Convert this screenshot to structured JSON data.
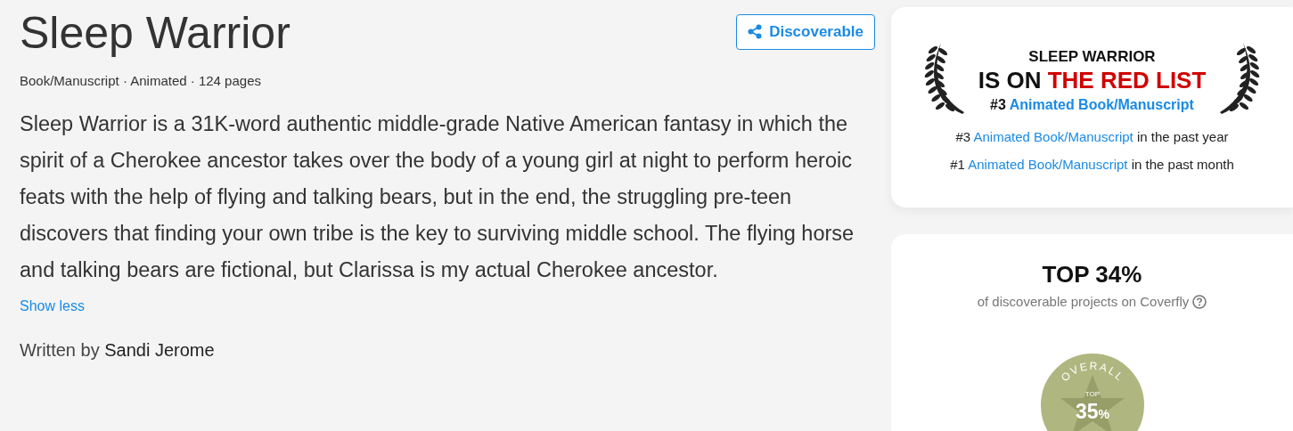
{
  "project": {
    "title": "Sleep Warrior",
    "meta": "Book/Manuscript · Animated · 124 pages",
    "description": "Sleep Warrior is a 31K-word authentic middle-grade Native American fantasy in which the spirit of a Cherokee ancestor takes over the body of a young girl at night to perform heroic feats with the help of flying and talking bears, but in the end, the struggling pre-teen discovers that finding your own tribe is the key to surviving middle school. The flying horse and talking bears are fictional, but Clarissa is my actual Cherokee ancestor.",
    "toggle": "Show less",
    "author_prefix": "Written by",
    "author": "Sandi Jerome",
    "status_button": "Discoverable"
  },
  "red_list": {
    "title": "SLEEP WARRIOR",
    "headline_prefix": "IS ON",
    "headline_highlight": "THE RED LIST",
    "rank": "#3",
    "category": "Animated Book/Manuscript",
    "stats": [
      {
        "rank": "#3",
        "category": "Animated Book/Manuscript",
        "period": "in the past year"
      },
      {
        "rank": "#1",
        "category": "Animated Book/Manuscript",
        "period": "in the past month"
      }
    ]
  },
  "percentile": {
    "heading": "TOP 34%",
    "caption": "of discoverable projects on Coverfly"
  },
  "medal": {
    "arc": "OVERALL",
    "label": "TOP",
    "value": "35",
    "unit": "%"
  }
}
